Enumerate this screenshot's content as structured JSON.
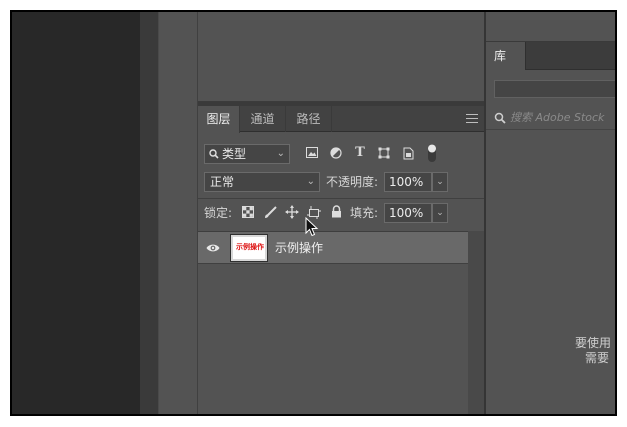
{
  "layers_panel": {
    "tabs": [
      {
        "label": "图层",
        "active": true
      },
      {
        "label": "通道",
        "active": false
      },
      {
        "label": "路径",
        "active": false
      }
    ],
    "filter": {
      "kind_label": "类型",
      "filter_icons": [
        "image-filter-icon",
        "adjustment-filter-icon",
        "type-filter-icon",
        "shape-filter-icon",
        "smart-object-filter-icon",
        "filter-toggle-icon"
      ]
    },
    "blend_mode": "正常",
    "opacity": {
      "label": "不透明度:",
      "value": "100%"
    },
    "lock": {
      "label": "锁定:",
      "icons": [
        "lock-transparent-pixels-icon",
        "lock-image-pixels-icon",
        "lock-position-icon",
        "lock-artboard-icon",
        "lock-all-icon"
      ]
    },
    "fill": {
      "label": "填充:",
      "value": "100%"
    },
    "layers": [
      {
        "name": "示例操作",
        "thumbnail_text": "示例操作",
        "visible": true,
        "selected": true
      }
    ]
  },
  "library_panel": {
    "tab_label": "库",
    "search_placeholder": "搜索 Adobe Stock",
    "message_line1": "要使用",
    "message_line2": "需要"
  },
  "colors": {
    "panel_bg": "#535353",
    "dark_bg": "#282828",
    "selected_layer": "#696969",
    "thumbnail_text": "#dd1111"
  }
}
